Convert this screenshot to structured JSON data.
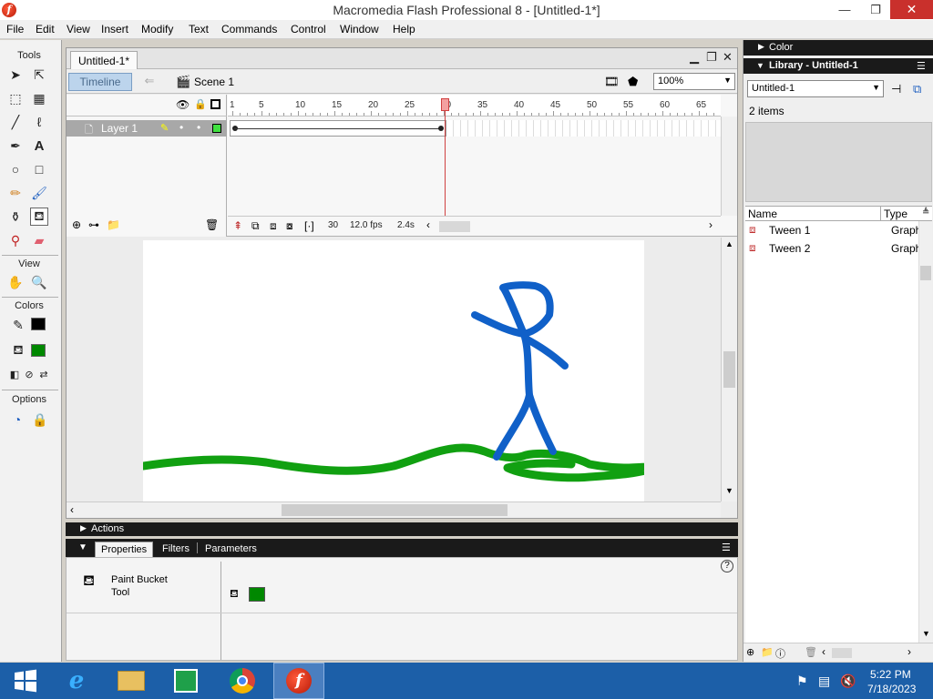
{
  "window": {
    "title": "Macromedia Flash Professional 8 - [Untitled-1*]",
    "app_icon": "f",
    "min_glyph": "—",
    "max_glyph": "❐",
    "close_glyph": "✕"
  },
  "menu": [
    "File",
    "Edit",
    "View",
    "Insert",
    "Modify",
    "Text",
    "Commands",
    "Control",
    "Window",
    "Help"
  ],
  "tools_panel": {
    "title": "Tools",
    "view_title": "View",
    "colors_title": "Colors",
    "options_title": "Options",
    "stroke_color": "#000000",
    "fill_color": "#008800"
  },
  "document": {
    "tab_label": "Untitled-1*",
    "timeline_button": "Timeline",
    "scene_label": "Scene 1",
    "zoom_value": "100%"
  },
  "timeline": {
    "layer_name": "Layer 1",
    "ruler_numbers": [
      "1",
      "5",
      "10",
      "15",
      "20",
      "25",
      "30",
      "35",
      "40",
      "45",
      "50",
      "55",
      "60",
      "65"
    ],
    "current_frame": "30",
    "frame_rate": "12.0 fps",
    "elapsed_time": "2.4s"
  },
  "panels": {
    "actions_label": "Actions",
    "properties_tab": "Properties",
    "filters_tab": "Filters",
    "parameters_tab": "Parameters",
    "tool_name_line1": "Paint Bucket",
    "tool_name_line2": "Tool",
    "fill_swatch_color": "#008800"
  },
  "right_panels": {
    "color_label": "Color",
    "library_label": "Library - Untitled-1",
    "library_select": "Untitled-1",
    "items_count": "2 items",
    "col_name": "Name",
    "col_type": "Type",
    "items": [
      {
        "name": "Tween 1",
        "type": "Graph"
      },
      {
        "name": "Tween 2",
        "type": "Graph"
      }
    ]
  },
  "stage": {
    "figure_color": "#1060c8",
    "ground_color": "#11a011"
  },
  "taskbar": {
    "time": "5:22 PM",
    "date": "7/18/2023"
  }
}
